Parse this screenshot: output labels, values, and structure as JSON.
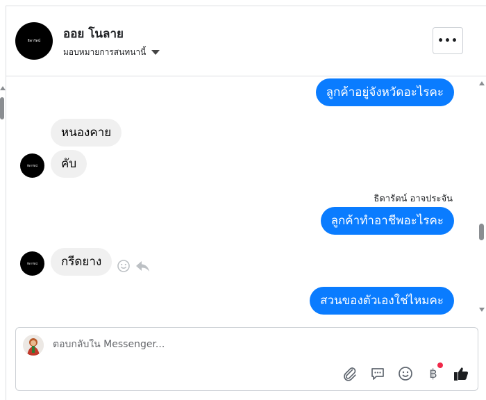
{
  "header": {
    "avatar_text": "ธิดารัตน์",
    "contact_name": "ออย โนลาย",
    "assign_label": "มอบหมายการสนทนานี้",
    "more_label": "•••"
  },
  "thread": {
    "messages": [
      {
        "dir": "out",
        "text": "ลูกค้าอยู่จังหวัดอะไรคะ"
      },
      {
        "dir": "in",
        "text": "หนองคาย"
      },
      {
        "dir": "in",
        "text": "คับ"
      },
      {
        "dir": "out",
        "text": "ลูกค้าทำอาชีพอะไรคะ"
      },
      {
        "dir": "in",
        "text": "กรีดยาง"
      },
      {
        "dir": "out",
        "text": "สวนของตัวเองใช่ไหมคะ"
      }
    ],
    "sender_label": "ธิดารัตน์ อาจประจัน",
    "avatar_text": "ธิดารัตน์"
  },
  "composer": {
    "placeholder": "ตอบกลับใน Messenger...",
    "value": "",
    "currency_symbol": "฿",
    "icons": [
      "paperclip-icon",
      "chat-bubble-icon",
      "smiley-icon",
      "baht-icon",
      "thumbs-up-icon"
    ]
  },
  "colors": {
    "outgoing": "#0a7cff",
    "incoming": "#f0f0f0",
    "notification_dot": "#f02849"
  }
}
